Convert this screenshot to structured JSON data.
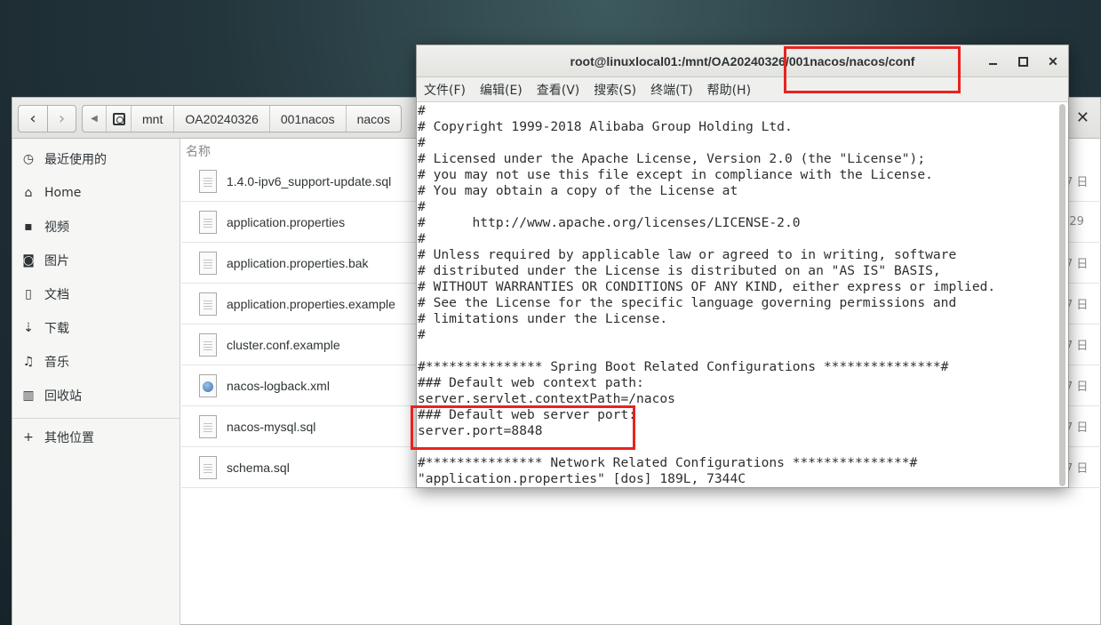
{
  "file_manager": {
    "back_icon": "chevron-left",
    "forward_icon": "chevron-right",
    "path_icon": "drive-icon",
    "breadcrumbs": [
      "mnt",
      "OA20240326",
      "001nacos",
      "nacos"
    ],
    "close_glyph": "✕",
    "sidebar": [
      {
        "icon": "clock-icon",
        "glyph": "◷",
        "label": "最近使用的"
      },
      {
        "icon": "home-icon",
        "glyph": "⌂",
        "label": "Home"
      },
      {
        "icon": "video-icon",
        "glyph": "▪",
        "label": "视频"
      },
      {
        "icon": "camera-icon",
        "glyph": "◙",
        "label": "图片"
      },
      {
        "icon": "document-icon",
        "glyph": "▯",
        "label": "文档"
      },
      {
        "icon": "download-icon",
        "glyph": "⇣",
        "label": "下载"
      },
      {
        "icon": "music-icon",
        "glyph": "♫",
        "label": "音乐"
      },
      {
        "icon": "trash-icon",
        "glyph": "▥",
        "label": "回收站"
      },
      {
        "icon": "plus-icon",
        "glyph": "+",
        "label": "其他位置"
      }
    ],
    "column_header": "名称",
    "files": [
      {
        "name": "1.4.0-ipv6_support-update.sql",
        "date": "7 日",
        "icon": "text-file-icon"
      },
      {
        "name": "application.properties",
        "date": ":29",
        "icon": "text-file-icon"
      },
      {
        "name": "application.properties.bak",
        "date": "7 日",
        "icon": "text-file-icon"
      },
      {
        "name": "application.properties.example",
        "date": "7 日",
        "icon": "text-file-icon"
      },
      {
        "name": "cluster.conf.example",
        "date": "7 日",
        "icon": "text-file-icon"
      },
      {
        "name": "nacos-logback.xml",
        "date": "7 日",
        "icon": "xml-file-icon"
      },
      {
        "name": "nacos-mysql.sql",
        "date": "7 日",
        "icon": "text-file-icon"
      },
      {
        "name": "schema.sql",
        "date": "7 日",
        "icon": "text-file-icon"
      }
    ]
  },
  "terminal": {
    "title": "root@linuxlocal01:/mnt/OA20240326/001nacos/nacos/conf",
    "menu": [
      "文件(F)",
      "编辑(E)",
      "查看(V)",
      "搜索(S)",
      "终端(T)",
      "帮助(H)"
    ],
    "lines": [
      "#",
      "# Copyright 1999-2018 Alibaba Group Holding Ltd.",
      "#",
      "# Licensed under the Apache License, Version 2.0 (the \"License\");",
      "# you may not use this file except in compliance with the License.",
      "# You may obtain a copy of the License at",
      "#",
      "#      http://www.apache.org/licenses/LICENSE-2.0",
      "#",
      "# Unless required by applicable law or agreed to in writing, software",
      "# distributed under the License is distributed on an \"AS IS\" BASIS,",
      "# WITHOUT WARRANTIES OR CONDITIONS OF ANY KIND, either express or implied.",
      "# See the License for the specific language governing permissions and",
      "# limitations under the License.",
      "#",
      "",
      "#*************** Spring Boot Related Configurations ***************#",
      "### Default web context path:",
      "server.servlet.contextPath=/nacos",
      "### Default web server port:",
      "server.port=8848",
      "",
      "#*************** Network Related Configurations ***************#",
      "\"application.properties\" [dos] 189L, 7344C"
    ]
  },
  "colors": {
    "annotation": "#e8231f"
  }
}
